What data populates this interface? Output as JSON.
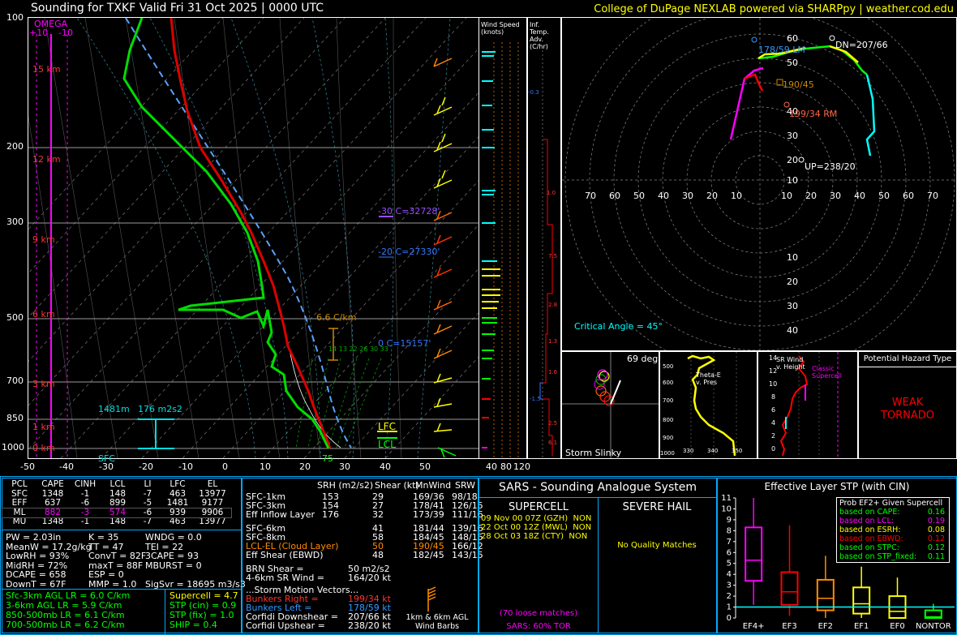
{
  "header": {
    "title": "Sounding for TXKF Valid  Fri 31 Oct 2025 | 0000 UTC",
    "credit": "College of DuPage NEXLAB powered via SHARPpy | weather.cod.edu"
  },
  "skewt": {
    "pressure_labels": [
      "100",
      "200",
      "300",
      "500",
      "700",
      "850",
      "1000"
    ],
    "temp_labels": [
      "-50",
      "-40",
      "-30",
      "-20",
      "-10",
      "0",
      "10",
      "20",
      "30",
      "40",
      "50"
    ],
    "height_labels": [
      "15 km",
      "12 km",
      "9 km",
      "6 km",
      "3 km",
      "1 km",
      "0 km"
    ],
    "omega_title": "OMEGA",
    "omega_left": "+10",
    "omega_right": "-10",
    "annotations": {
      "m30": "-30 C=32728'",
      "m20": "-20 C=27330'",
      "zero": "0 C=15157'",
      "lapse": "6.6 C/km",
      "lfc": "LFC",
      "lcl": "LCL",
      "sfc": "SFC",
      "sfc_temp": "75",
      "inflow_depth": "1481m",
      "inflow_srh": "176 m2s2",
      "wetbulb_ticks": [
        "14",
        "13",
        "22",
        "26",
        "30",
        "33"
      ]
    }
  },
  "wind_speed": {
    "title": "Wind Speed (knots)",
    "ticks": [
      "40",
      "80",
      "120"
    ]
  },
  "temp_adv": {
    "title": "Inf. Temp. Adv. (C/hr)",
    "values": [
      "-0.3",
      "1.0",
      "7.5",
      "2.8",
      "1.3",
      "1.6",
      "-1.5",
      "2.5",
      "6.1"
    ]
  },
  "hodograph": {
    "rings": [
      "10",
      "20",
      "30",
      "40",
      "50",
      "60"
    ],
    "x_ticks": [
      "70",
      "60",
      "50",
      "40",
      "30",
      "20",
      "10",
      "10",
      "20",
      "30",
      "40",
      "50",
      "60",
      "70"
    ],
    "labels": {
      "lm": "178/59 LM",
      "dn": "DN=207/66",
      "mean": "190/45",
      "rm": "199/34 RM",
      "up": "UP=238/20"
    },
    "critical_angle": "Critical Angle = 45°"
  },
  "storm_slinky": {
    "deg": "69 deg",
    "label": "Storm Slinky"
  },
  "theta_e": {
    "label": "Theta-E v. Pres",
    "ylabels": [
      "500",
      "600",
      "700",
      "800",
      "900",
      "1000"
    ],
    "xlabels": [
      "330",
      "340",
      "350"
    ]
  },
  "sr_wind": {
    "label": "SR Wind v. Height",
    "classic": "Classic Supercell",
    "ylabels": [
      "14",
      "12",
      "10",
      "8",
      "6",
      "4",
      "2",
      "0"
    ]
  },
  "hazard": {
    "title": "Potential Hazard Type",
    "value": "WEAK TORNADO",
    "color": "#ff0000"
  },
  "parcels": {
    "headers": [
      "PCL",
      "CAPE",
      "CINH",
      "LCL",
      "LI",
      "LFC",
      "EL"
    ],
    "rows": [
      [
        "SFC",
        "1348",
        "-1",
        "148",
        "-7",
        "463",
        "13977"
      ],
      [
        "EFF",
        "637",
        "-6",
        "899",
        "-5",
        "1481",
        "9177"
      ],
      [
        "ML",
        "882",
        "-3",
        "574",
        "-6",
        "939",
        "9906"
      ],
      [
        "MU",
        "1348",
        "-1",
        "148",
        "-7",
        "463",
        "13977"
      ]
    ]
  },
  "indices": [
    [
      "PW = 2.03in",
      "K = 35",
      "WNDG = 0.0"
    ],
    [
      "MeanW = 17.2g/kg",
      "TT = 47",
      "TEI = 22"
    ],
    [
      "LowRH = 93%",
      "ConvT = 82F",
      "3CAPE = 93"
    ],
    [
      "MidRH = 72%",
      "maxT = 88F",
      "MBURST = 0"
    ],
    [
      "DCAPE = 658",
      "ESP = 0",
      ""
    ],
    [
      "DownT = 67F",
      "MMP = 1.0",
      "SigSvr = 18695 m3/s3"
    ]
  ],
  "lapse_rates": [
    "Sfc-3km AGL LR = 6.0 C/km",
    "3-6km AGL LR = 5.9 C/km",
    "850-500mb LR = 6.1 C/km",
    "700-500mb LR = 6.2 C/km"
  ],
  "composites": [
    "Supercell = 4.7",
    "STP (cin) = 0.9",
    "STP (fix) = 1.0",
    "SHIP = 0.4"
  ],
  "kinematics": {
    "headers": [
      "SRH (m2/s2)",
      "Shear (kt)",
      "MnWind",
      "SRW"
    ],
    "rows": [
      [
        "SFC-1km",
        "153",
        "29",
        "169/36",
        "98/18"
      ],
      [
        "SFC-3km",
        "154",
        "27",
        "178/41",
        "126/15"
      ],
      [
        "Eff Inflow Layer",
        "176",
        "32",
        "173/39",
        "111/16"
      ],
      [
        "SFC-6km",
        "41",
        "181/44",
        "139/16"
      ],
      [
        "SFC-8km",
        "58",
        "184/45",
        "148/15"
      ],
      [
        "LCL-EL (Cloud Layer)",
        "50",
        "190/45",
        "166/12"
      ],
      [
        "Eff Shear (EBWD)",
        "48",
        "182/45",
        "143/15"
      ]
    ],
    "brn_shear": "BRN Shear =",
    "brn_shear_val": "50 m2/s2",
    "sr46": "4-6km SR Wind =",
    "sr46_val": "164/20 kt",
    "storm_motion_title": "...Storm Motion Vectors...",
    "bunkers_right": "Bunkers Right =",
    "bunkers_right_val": "199/34 kt",
    "bunkers_left": "Bunkers Left =",
    "bunkers_left_val": "178/59 kt",
    "corfidi_down": "Corfidi Downshear =",
    "corfidi_down_val": "207/66 kt",
    "corfidi_up": "Corfidi Upshear =",
    "corfidi_up_val": "238/20 kt",
    "barb_label": "1km & 6km AGL Wind Barbs"
  },
  "sars": {
    "title": "SARS - Sounding Analogue System",
    "supercell_title": "SUPERCELL",
    "hail_title": "SEVERE HAIL",
    "matches": [
      "09 Nov 00 07Z (GZH)  NON",
      "22 Oct 00 12Z (MWL)  NON",
      "28 Oct 03 18Z (CTY)  NON"
    ],
    "hail_matches": "No Quality Matches",
    "loose": "(70 loose matches)",
    "tor": "SARS: 60% TOR"
  },
  "stp_chart": {
    "title": "Effective Layer STP (with CIN)",
    "legend_title": "Prob EF2+ Given Supercell",
    "legend": [
      {
        "label": "based on CAPE:",
        "value": "0.16",
        "color": "#00ff00"
      },
      {
        "label": "based on LCL:",
        "value": "0.19",
        "color": "#ff00ff"
      },
      {
        "label": "based on ESRH:",
        "value": "0.08",
        "color": "#ffff00"
      },
      {
        "label": "based on EBWD:",
        "value": "0.12",
        "color": "#ff0000"
      },
      {
        "label": "based on STPC:",
        "value": "0.12",
        "color": "#00ff00"
      },
      {
        "label": "based on STP_fixed:",
        "value": "0.11",
        "color": "#00ff00"
      }
    ],
    "yticks": [
      "11",
      "10",
      "9",
      "8",
      "7",
      "6",
      "5",
      "4",
      "3",
      "2",
      "1",
      "0"
    ],
    "categories": [
      "EF4+",
      "EF3",
      "EF2",
      "EF1",
      "EF0",
      "NONTOR"
    ]
  },
  "chart_data": {
    "type": "box",
    "title": "Effective Layer STP (with CIN)",
    "categories": [
      "EF4+",
      "EF3",
      "EF2",
      "EF1",
      "EF0",
      "NONTOR"
    ],
    "ylim": [
      0,
      11
    ],
    "boxes": [
      {
        "lo": 1.2,
        "q1": 3.4,
        "med": 5.3,
        "q3": 8.3,
        "hi": 11.0,
        "color": "#ff00ff"
      },
      {
        "lo": 0.2,
        "q1": 1.2,
        "med": 2.4,
        "q3": 4.2,
        "hi": 8.5,
        "color": "#ff0000"
      },
      {
        "lo": 0.0,
        "q1": 0.7,
        "med": 1.8,
        "q3": 3.5,
        "hi": 5.7,
        "color": "#ff8c00"
      },
      {
        "lo": 0.0,
        "q1": 0.4,
        "med": 1.3,
        "q3": 2.8,
        "hi": 4.7,
        "color": "#ffff00"
      },
      {
        "lo": 0.0,
        "q1": 0.0,
        "med": 0.6,
        "q3": 2.0,
        "hi": 3.7,
        "color": "#ffff00"
      },
      {
        "lo": 0.0,
        "q1": 0.0,
        "med": 0.1,
        "q3": 0.7,
        "hi": 1.3,
        "color": "#00ff00"
      }
    ],
    "reference_line": 1.0
  }
}
